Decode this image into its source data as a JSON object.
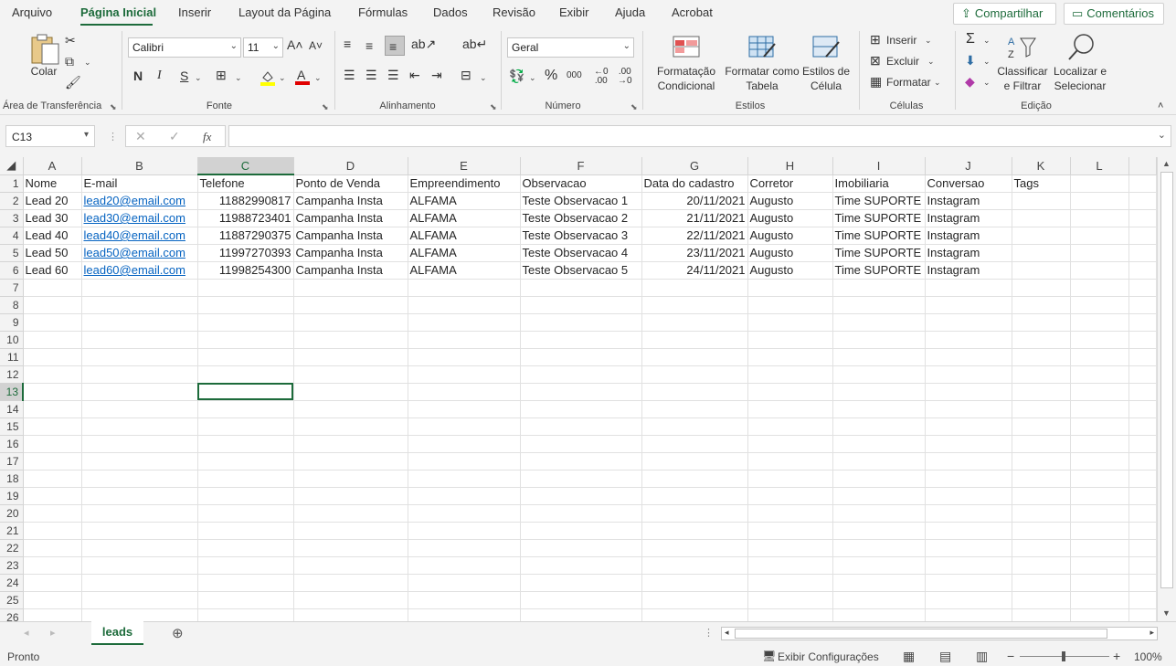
{
  "menu": {
    "tabs": [
      "Arquivo",
      "Página Inicial",
      "Inserir",
      "Layout da Página",
      "Fórmulas",
      "Dados",
      "Revisão",
      "Exibir",
      "Ajuda",
      "Acrobat"
    ],
    "share": "Compartilhar",
    "comments": "Comentários"
  },
  "ribbon": {
    "clipboard": {
      "paste": "Colar",
      "label": "Área de Transferência"
    },
    "font": {
      "name": "Calibri",
      "size": "11",
      "bold": "N",
      "italic": "I",
      "underline": "S",
      "label": "Fonte"
    },
    "alignment": {
      "label": "Alinhamento"
    },
    "number": {
      "format": "Geral",
      "label": "Número"
    },
    "styles": {
      "conditional": [
        "Formatação",
        "Condicional"
      ],
      "table": [
        "Formatar como",
        "Tabela"
      ],
      "cell": [
        "Estilos de",
        "Célula"
      ],
      "label": "Estilos"
    },
    "cells": {
      "insert": "Inserir",
      "delete": "Excluir",
      "format": "Formatar",
      "label": "Células"
    },
    "editing": {
      "sort": [
        "Classificar",
        "e Filtrar"
      ],
      "find": [
        "Localizar e",
        "Selecionar"
      ],
      "label": "Edição"
    }
  },
  "formula_bar": {
    "name_box": "C13",
    "fx": "fx",
    "value": ""
  },
  "sheet": {
    "columns": [
      "A",
      "B",
      "C",
      "D",
      "E",
      "F",
      "G",
      "H",
      "I",
      "J",
      "K",
      "L"
    ],
    "header_row": [
      "Nome",
      "E-mail",
      "Telefone",
      "Ponto de Venda",
      "Empreendimento",
      "Observacao",
      "Data do cadastro",
      "Corretor",
      "Imobiliaria",
      "Conversao",
      "Tags",
      ""
    ],
    "rows": [
      [
        "Lead 20",
        "lead20@email.com",
        "11882990817",
        "Campanha Insta",
        "ALFAMA",
        "Teste Observacao 1",
        "20/11/2021",
        "Augusto",
        "Time SUPORTE",
        "Instagram",
        "",
        ""
      ],
      [
        "Lead 30",
        "lead30@email.com",
        "11988723401",
        "Campanha Insta",
        "ALFAMA",
        "Teste Observacao 2",
        "21/11/2021",
        "Augusto",
        "Time SUPORTE",
        "Instagram",
        "",
        ""
      ],
      [
        "Lead 40",
        "lead40@email.com",
        "11887290375",
        "Campanha Insta",
        "ALFAMA",
        "Teste Observacao 3",
        "22/11/2021",
        "Augusto",
        "Time SUPORTE",
        "Instagram",
        "",
        ""
      ],
      [
        "Lead 50",
        "lead50@email.com",
        "11997270393",
        "Campanha Insta",
        "ALFAMA",
        "Teste Observacao 4",
        "23/11/2021",
        "Augusto",
        "Time SUPORTE",
        "Instagram",
        "",
        ""
      ],
      [
        "Lead 60",
        "lead60@email.com",
        "11998254300",
        "Campanha Insta",
        "ALFAMA",
        "Teste Observacao 5",
        "24/11/2021",
        "Augusto",
        "Time SUPORTE",
        "Instagram",
        "",
        ""
      ]
    ],
    "row_numbers": [
      "1",
      "2",
      "3",
      "4",
      "5",
      "6",
      "7",
      "8",
      "9",
      "10",
      "11",
      "12",
      "13",
      "14",
      "15",
      "16",
      "17",
      "18",
      "19",
      "20",
      "21",
      "22",
      "23",
      "24",
      "25",
      "26"
    ],
    "selected_cell": "C13",
    "sheet_tab": "leads"
  },
  "status": {
    "ready": "Pronto",
    "display_settings": "Exibir Configurações",
    "zoom": "100%"
  },
  "colors": {
    "accent": "#1d6b3b",
    "link": "#0563c1"
  }
}
